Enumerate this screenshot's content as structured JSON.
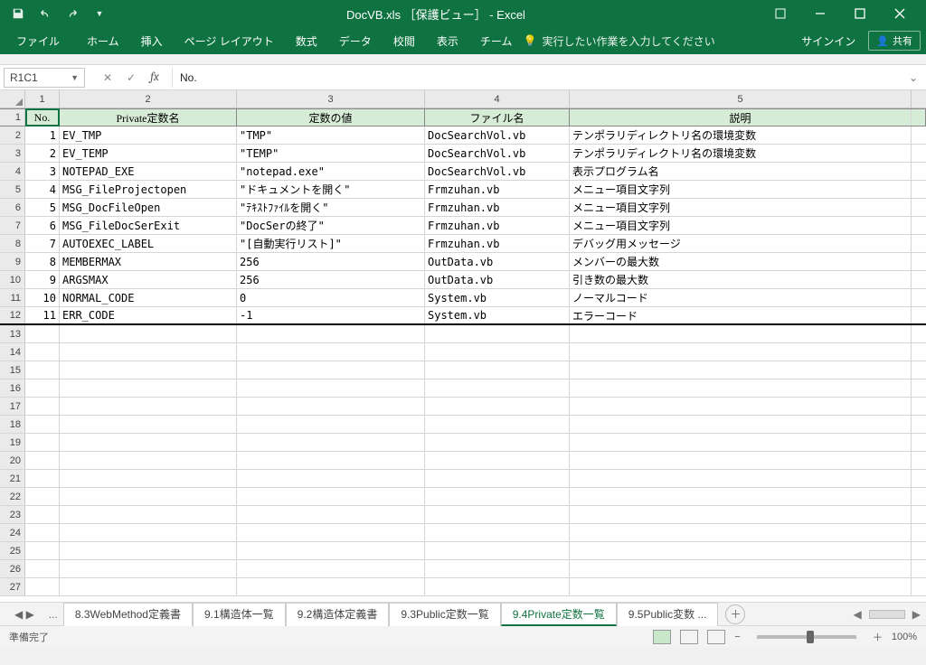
{
  "titlebar": {
    "title": "DocVB.xls ［保護ビュー］ - Excel"
  },
  "ribbon": {
    "file": "ファイル",
    "tabs": [
      "ホーム",
      "挿入",
      "ページ レイアウト",
      "数式",
      "データ",
      "校閲",
      "表示",
      "チーム"
    ],
    "tellme": "実行したい作業を入力してください",
    "sign_in": "サインイン",
    "share": "共有"
  },
  "formula_bar": {
    "name_box": "R1C1",
    "formula": "No."
  },
  "col_headers": [
    "1",
    "2",
    "3",
    "4",
    "5"
  ],
  "data_headers": {
    "no": "No.",
    "name": "Private定数名",
    "value": "定数の値",
    "file": "ファイル名",
    "desc": "説明"
  },
  "rows": [
    {
      "no": "1",
      "name": "EV_TMP",
      "value": "\"TMP\"",
      "file": "DocSearchVol.vb",
      "desc": "テンポラリディレクトリ名の環境変数"
    },
    {
      "no": "2",
      "name": "EV_TEMP",
      "value": "\"TEMP\"",
      "file": "DocSearchVol.vb",
      "desc": "テンポラリディレクトリ名の環境変数"
    },
    {
      "no": "3",
      "name": "NOTEPAD_EXE",
      "value": "\"notepad.exe\"",
      "file": "DocSearchVol.vb",
      "desc": "表示プログラム名"
    },
    {
      "no": "4",
      "name": "MSG_FileProjectopen",
      "value": "\"ドキュメントを開く\"",
      "file": "Frmzuhan.vb",
      "desc": "メニュー項目文字列"
    },
    {
      "no": "5",
      "name": "MSG_DocFileOpen",
      "value": "\"ﾃｷｽﾄﾌｧｲﾙを開く\"",
      "file": "Frmzuhan.vb",
      "desc": "メニュー項目文字列"
    },
    {
      "no": "6",
      "name": "MSG_FileDocSerExit",
      "value": "\"DocSerの終了\"",
      "file": "Frmzuhan.vb",
      "desc": "メニュー項目文字列"
    },
    {
      "no": "7",
      "name": "AUTOEXEC_LABEL",
      "value": "\"[自動実行リスト]\"",
      "file": "Frmzuhan.vb",
      "desc": "デバッグ用メッセージ"
    },
    {
      "no": "8",
      "name": "MEMBERMAX",
      "value": "256",
      "file": "OutData.vb",
      "desc": "メンバーの最大数"
    },
    {
      "no": "9",
      "name": "ARGSMAX",
      "value": "256",
      "file": "OutData.vb",
      "desc": "引き数の最大数"
    },
    {
      "no": "10",
      "name": "NORMAL_CODE",
      "value": "0",
      "file": "System.vb",
      "desc": "ノーマルコード"
    },
    {
      "no": "11",
      "name": "ERR_CODE",
      "value": "-1",
      "file": "System.vb",
      "desc": "エラーコード"
    }
  ],
  "blank_rows_start": 13,
  "blank_rows_end": 27,
  "sheet_tabs": [
    "8.3WebMethod定義書",
    "9.1構造体一覧",
    "9.2構造体定義書",
    "9.3Public定数一覧",
    "9.4Private定数一覧",
    "9.5Public変数 ..."
  ],
  "active_sheet_index": 4,
  "status_bar": {
    "ready": "準備完了",
    "zoom": "100%"
  }
}
